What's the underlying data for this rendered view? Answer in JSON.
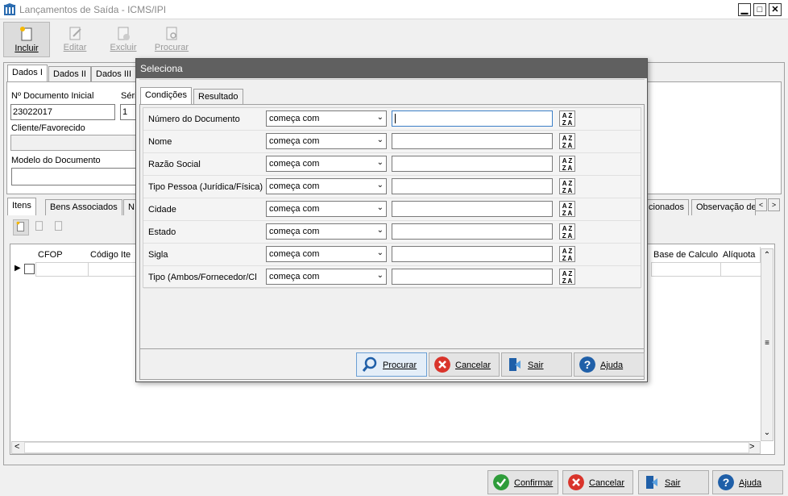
{
  "window": {
    "title": "Lançamentos de Saída - ICMS/IPI",
    "min": "▁",
    "max": "□",
    "close": "✕"
  },
  "toolbar": {
    "incluir": "Incluir",
    "editar": "Editar",
    "excluir": "Excluir",
    "procurar": "Procurar"
  },
  "tabs_top": [
    "Dados I",
    "Dados II",
    "Dados III"
  ],
  "form": {
    "doc_inicial_label": "Nº Documento Inicial",
    "doc_inicial_value": "23022017",
    "serie_label": "Séri",
    "serie_value": "1",
    "cliente_label": "Cliente/Favorecido",
    "modelo_label": "Modelo do Documento"
  },
  "tabs_bottom": [
    "Itens",
    "Bens Associados",
    "N"
  ],
  "tabs_bottom_right": [
    "cionados",
    "Observação de"
  ],
  "grid": {
    "col_cfop": "CFOP",
    "col_codigo": "Código Ite",
    "col_base": "Base de Calculo",
    "col_aliquota": "Alíquota"
  },
  "footer": {
    "confirmar": "Confirmar",
    "cancelar": "Cancelar",
    "sair": "Sair",
    "ajuda": "Ajuda"
  },
  "dialog": {
    "title": "Seleciona",
    "tab_condicoes": "Condições",
    "tab_resultado": "Resultado",
    "rows": [
      {
        "label": "Número do Documento",
        "op": "começa com"
      },
      {
        "label": "Nome",
        "op": "começa com"
      },
      {
        "label": "Razão Social",
        "op": "começa com"
      },
      {
        "label": "Tipo Pessoa (Jurídica/Física)",
        "op": "começa com"
      },
      {
        "label": "Cidade",
        "op": "começa com"
      },
      {
        "label": "Estado",
        "op": "começa com"
      },
      {
        "label": "Sigla",
        "op": "começa com"
      },
      {
        "label": "Tipo (Ambos/Fornecedor/Cl",
        "op": "começa com"
      }
    ],
    "sort_top": "A Z",
    "sort_bottom": "Z A",
    "btn_procurar": "Procurar",
    "btn_cancelar": "Cancelar",
    "btn_sair": "Sair",
    "btn_ajuda": "Ajuda"
  },
  "colors": {
    "accent_green": "#2e9c3a",
    "accent_red": "#d9342b",
    "accent_blue": "#1f5fa8",
    "dialog_title": "#606060"
  }
}
